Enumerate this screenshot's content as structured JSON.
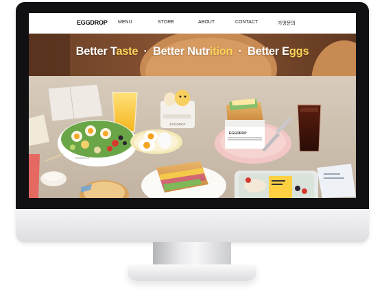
{
  "site": {
    "logo": "EGGDROP",
    "nav": [
      {
        "label": "MENU"
      },
      {
        "label": "STORE"
      },
      {
        "label": "ABOUT"
      },
      {
        "label": "CONTACT"
      },
      {
        "label": "가맹문의"
      }
    ]
  },
  "hero": {
    "phrase1_main": "Better T",
    "phrase1_accent": "aste",
    "separator": "·",
    "phrase2_main": "Better Nutr",
    "phrase2_accent": "ition",
    "phrase3_main": "Better E",
    "phrase3_accent": "ggs",
    "sandwich_box_label": "EGGDROP",
    "salad_bowl_label": "EGGDROP",
    "egg_cup_label": "EGGDROP"
  },
  "colors": {
    "wall": "#7a4a2e",
    "table": "#cdbfae",
    "title_text": "#ffffff",
    "title_accent": "#ffd45a",
    "egg_yolk": "#f5a623",
    "pink_plate": "#f2c7c5"
  }
}
